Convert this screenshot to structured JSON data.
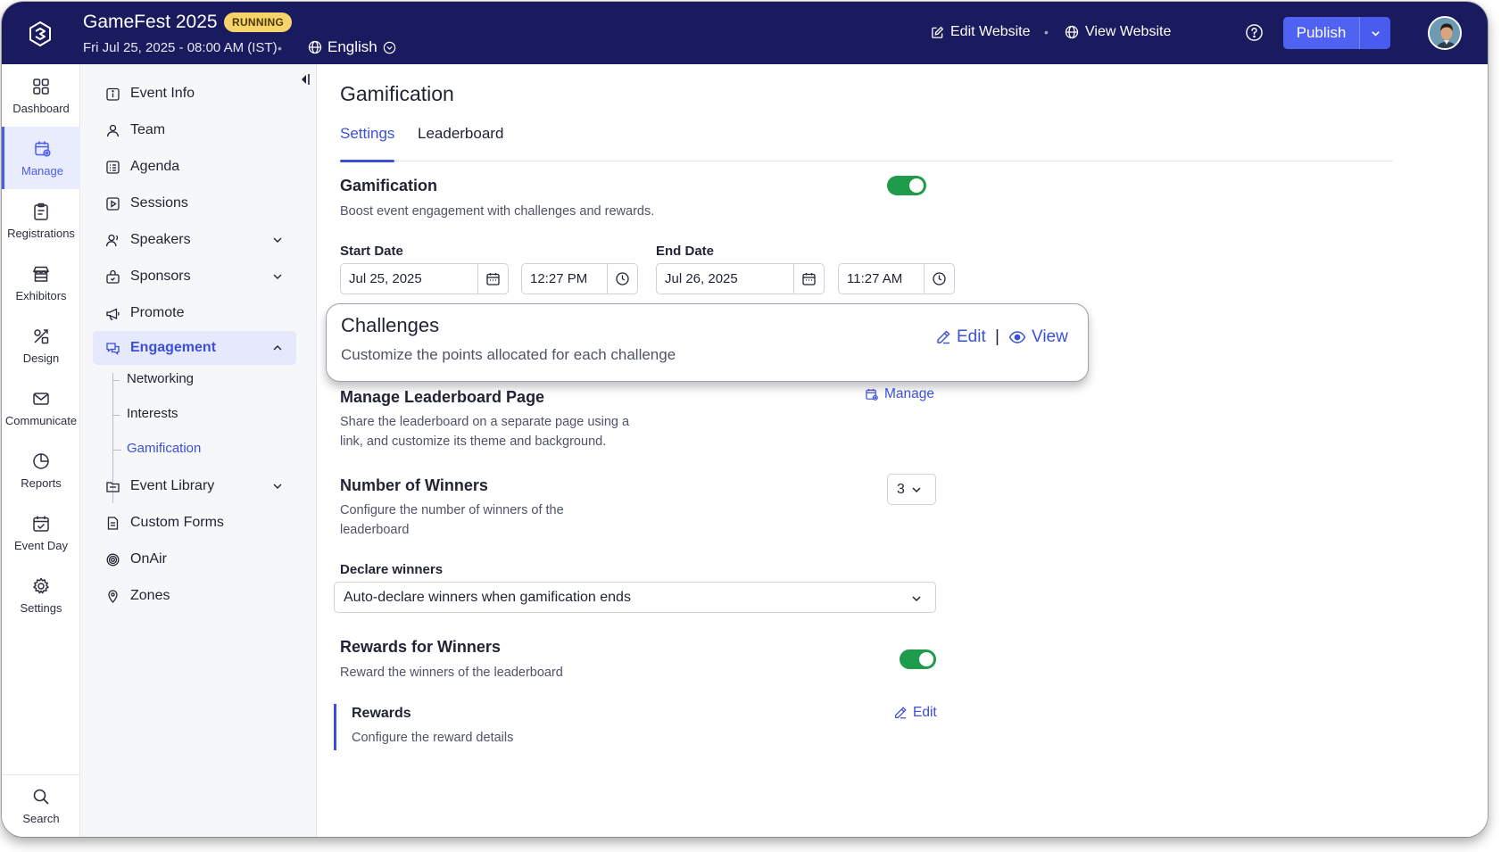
{
  "topbar": {
    "event_name": "GameFest 2025",
    "status": "RUNNING",
    "date": "Fri Jul 25, 2025 - 08:00 AM (IST)",
    "language": "English",
    "edit_website": "Edit Website",
    "view_website": "View Website",
    "publish": "Publish"
  },
  "rail": {
    "items": [
      {
        "label": "Dashboard",
        "icon": "grid-icon"
      },
      {
        "label": "Manage",
        "icon": "calendar-gear-icon"
      },
      {
        "label": "Registrations",
        "icon": "clipboard-icon"
      },
      {
        "label": "Exhibitors",
        "icon": "booth-icon"
      },
      {
        "label": "Design",
        "icon": "design-icon"
      },
      {
        "label": "Communicate",
        "icon": "mail-icon"
      },
      {
        "label": "Reports",
        "icon": "pie-chart-icon"
      },
      {
        "label": "Event Day",
        "icon": "calendar-check-icon"
      },
      {
        "label": "Settings",
        "icon": "gear-icon"
      }
    ],
    "search": "Search"
  },
  "subnav": {
    "items": [
      {
        "label": "Event Info"
      },
      {
        "label": "Team"
      },
      {
        "label": "Agenda"
      },
      {
        "label": "Sessions"
      },
      {
        "label": "Speakers"
      },
      {
        "label": "Sponsors"
      },
      {
        "label": "Promote"
      },
      {
        "label": "Engagement"
      },
      {
        "label": "Event Library"
      },
      {
        "label": "Custom Forms"
      },
      {
        "label": "OnAir"
      },
      {
        "label": "Zones"
      }
    ],
    "engagement_children": [
      "Networking",
      "Interests",
      "Gamification"
    ]
  },
  "main": {
    "title": "Gamification",
    "tabs": [
      "Settings",
      "Leaderboard"
    ],
    "gamification": {
      "title": "Gamification",
      "desc": "Boost event engagement with challenges and rewards.",
      "enabled": true
    },
    "start_date_label": "Start Date",
    "start_date": "Jul 25, 2025",
    "start_time": "12:27 PM",
    "end_date_label": "End Date",
    "end_date": "Jul 26, 2025",
    "end_time": "11:27 AM",
    "challenges": {
      "title": "Challenges",
      "desc": "Customize the points allocated for each challenge",
      "edit": "Edit",
      "separator": "|",
      "view": "View"
    },
    "leaderboard_page": {
      "title": "Manage Leaderboard Page",
      "desc_line1": "Share the leaderboard on a separate page using a",
      "desc_line2": "link, and customize its theme and background.",
      "manage": "Manage"
    },
    "winners": {
      "title": "Number of Winners",
      "desc_line1": "Configure the number of winners of the",
      "desc_line2": "leaderboard",
      "value": "3"
    },
    "declare": {
      "label": "Declare winners",
      "value": "Auto-declare winners when gamification ends"
    },
    "rewards_section": {
      "title": "Rewards for Winners",
      "desc": "Reward the winners of the leaderboard",
      "enabled": true
    },
    "rewards": {
      "title": "Rewards",
      "desc": "Configure the reward details",
      "edit": "Edit"
    }
  },
  "colors": {
    "topbar": "#1a1a5e",
    "accent": "#3c4fd9",
    "toggle_on": "#1e9b4b",
    "badge": "#f7d46b"
  }
}
